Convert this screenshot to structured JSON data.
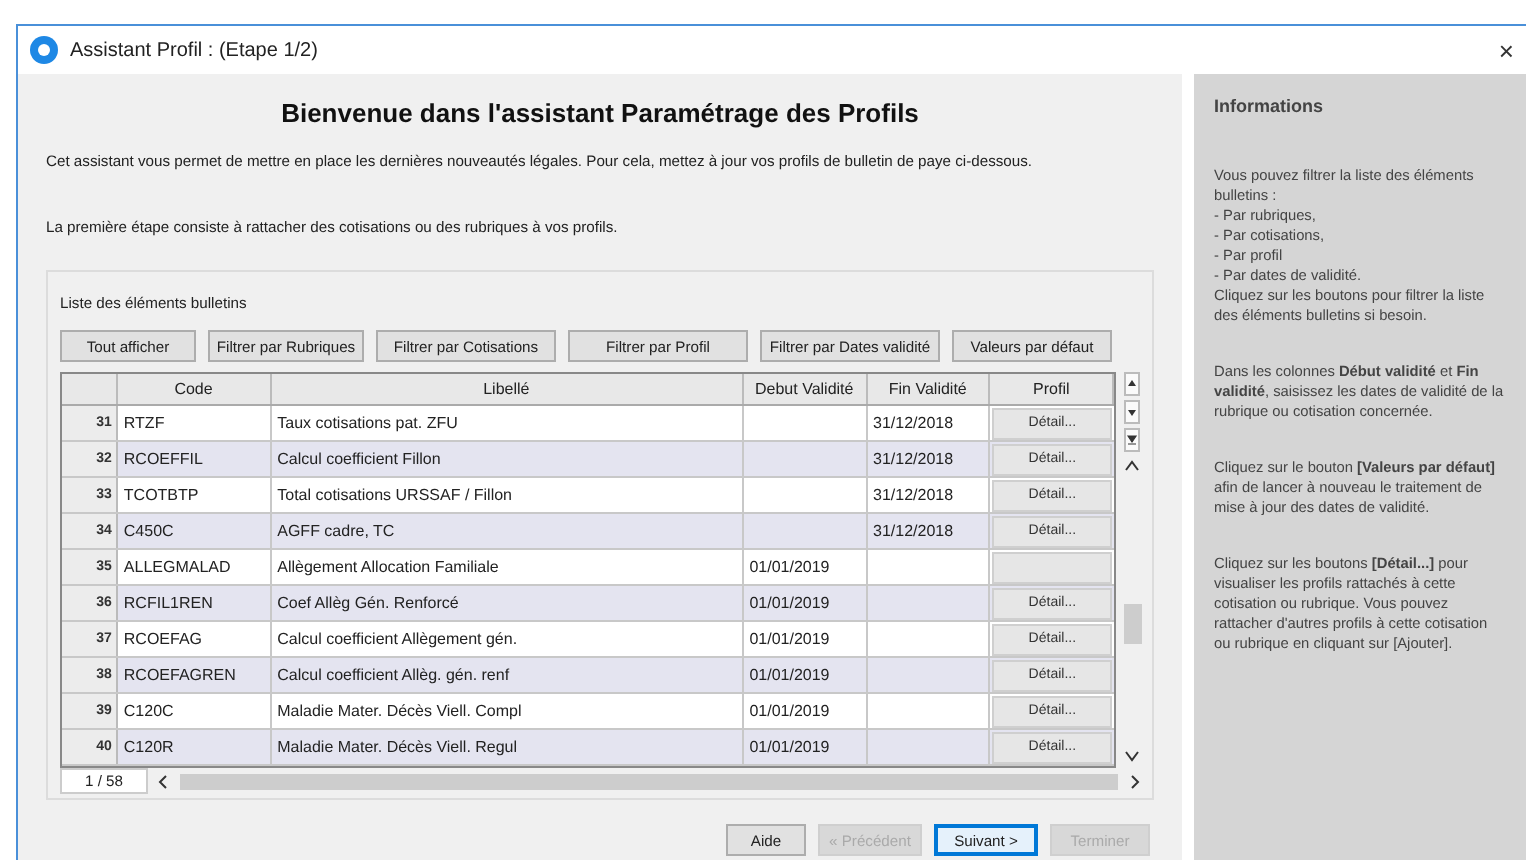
{
  "window": {
    "title": "Assistant Profil : (Etape 1/2)",
    "close": "×"
  },
  "heading": "Bienvenue dans l'assistant Paramétrage des Profils",
  "intro": [
    "Cet assistant vous permet de mettre en place les dernières nouveautés légales. Pour cela, mettez à jour vos profils de bulletin de paye ci-dessous.",
    "La première étape consiste à rattacher des cotisations ou des rubriques à vos profils."
  ],
  "list": {
    "title": "Liste des éléments bulletins",
    "filters": [
      "Tout afficher",
      "Filtrer par Rubriques",
      "Filtrer par Cotisations",
      "Filtrer par Profil",
      "Filtrer par Dates validité",
      "Valeurs par défaut"
    ],
    "columns": [
      "Code",
      "Libellé",
      "Debut Validité",
      "Fin Validité",
      "Profil"
    ],
    "rows": [
      {
        "num": "31",
        "code": "RTZF",
        "label": "Taux cotisations pat. ZFU",
        "start": "",
        "end": "31/12/2018",
        "detail": "Détail..."
      },
      {
        "num": "32",
        "code": "RCOEFFIL",
        "label": "Calcul coefficient Fillon",
        "start": "",
        "end": "31/12/2018",
        "detail": "Détail..."
      },
      {
        "num": "33",
        "code": "TCOTBTP",
        "label": "Total cotisations URSSAF / Fillon",
        "start": "",
        "end": "31/12/2018",
        "detail": "Détail..."
      },
      {
        "num": "34",
        "code": "C450C",
        "label": "AGFF cadre, TC",
        "start": "",
        "end": "31/12/2018",
        "detail": "Détail..."
      },
      {
        "num": "35",
        "code": "ALLEGMALAD",
        "label": "Allègement Allocation Familiale",
        "start": "01/01/2019",
        "end": "",
        "detail": ""
      },
      {
        "num": "36",
        "code": "RCFIL1REN",
        "label": "Coef Allèg Gén. Renforcé",
        "start": "01/01/2019",
        "end": "",
        "detail": "Détail..."
      },
      {
        "num": "37",
        "code": "RCOEFAG",
        "label": "Calcul coefficient Allègement gén.",
        "start": "01/01/2019",
        "end": "",
        "detail": "Détail..."
      },
      {
        "num": "38",
        "code": "RCOEFAGREN",
        "label": "Calcul coefficient Allèg. gén. renf",
        "start": "01/01/2019",
        "end": "",
        "detail": "Détail..."
      },
      {
        "num": "39",
        "code": "C120C",
        "label": "Maladie Mater. Décès Viell. Compl",
        "start": "01/01/2019",
        "end": "",
        "detail": "Détail..."
      },
      {
        "num": "40",
        "code": "C120R",
        "label": "Maladie Mater. Décès Viell. Regul",
        "start": "01/01/2019",
        "end": "",
        "detail": "Détail..."
      }
    ],
    "counter": "1 / 58"
  },
  "buttons": [
    {
      "label": "Aide",
      "disabled": false,
      "focused": false
    },
    {
      "label": "« Précédent",
      "disabled": true,
      "focused": false
    },
    {
      "label": "Suivant >",
      "disabled": false,
      "focused": true
    },
    {
      "label": "Terminer",
      "disabled": true,
      "focused": false
    }
  ],
  "info": {
    "title": "Informations",
    "paragraphs": [
      "Vous pouvez filtrer la liste des éléments bulletins :\n- Par rubriques,\n- Par cotisations,\n- Par profil\n- Par dates de validité.\nCliquez sur les boutons pour filtrer la liste des éléments bulletins si besoin.",
      "Dans les colonnes **Début validité** et **Fin validité**, saisissez les dates de validité de la rubrique ou cotisation concernée.",
      "Cliquez sur le bouton **[Valeurs par défaut]** afin de lancer à nouveau le traitement de mise à jour des dates de validité.",
      "Cliquez sur les boutons **[Détail...]** pour visualiser les profils rattachés à cette cotisation ou rubrique. Vous pouvez rattacher d'autres profils à cette cotisation ou rubrique en cliquant sur [Ajouter]."
    ]
  }
}
